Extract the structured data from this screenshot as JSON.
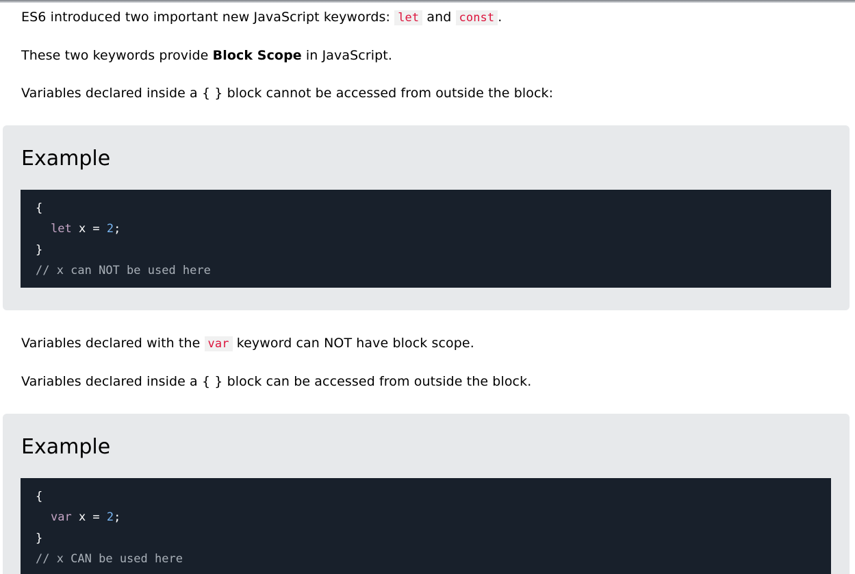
{
  "intro": {
    "line1_a": "ES6 introduced two important new JavaScript keywords: ",
    "line1_code1": "let",
    "line1_b": " and ",
    "line1_code2": "const",
    "line1_c": ".",
    "line2_a": "These two keywords provide ",
    "line2_bold": "Block Scope",
    "line2_b": " in JavaScript.",
    "line3": "Variables declared inside a { } block cannot be accessed from outside the block:"
  },
  "example1": {
    "heading": "Example",
    "code": {
      "open_brace": "{",
      "keyword": "let",
      "statement": " x = ",
      "number": "2",
      "semicolon": ";",
      "close_brace": "}",
      "comment": "// x can NOT be used here"
    }
  },
  "middle": {
    "line1_a": "Variables declared with the ",
    "line1_code": "var",
    "line1_b": " keyword can NOT have block scope.",
    "line2": "Variables declared inside a { } block can be accessed from outside the block."
  },
  "example2": {
    "heading": "Example",
    "code": {
      "open_brace": "{",
      "keyword": "var",
      "statement": " x = ",
      "number": "2",
      "semicolon": ";",
      "close_brace": "}",
      "comment": "// x CAN be used here"
    }
  },
  "colors": {
    "inline_code": "#dc143c",
    "example_bg": "#e7e9eb",
    "code_bg": "#18202b",
    "code_keyword": "#c5a5c5",
    "code_number": "#79b6f2",
    "code_comment": "#a9b0b8"
  }
}
